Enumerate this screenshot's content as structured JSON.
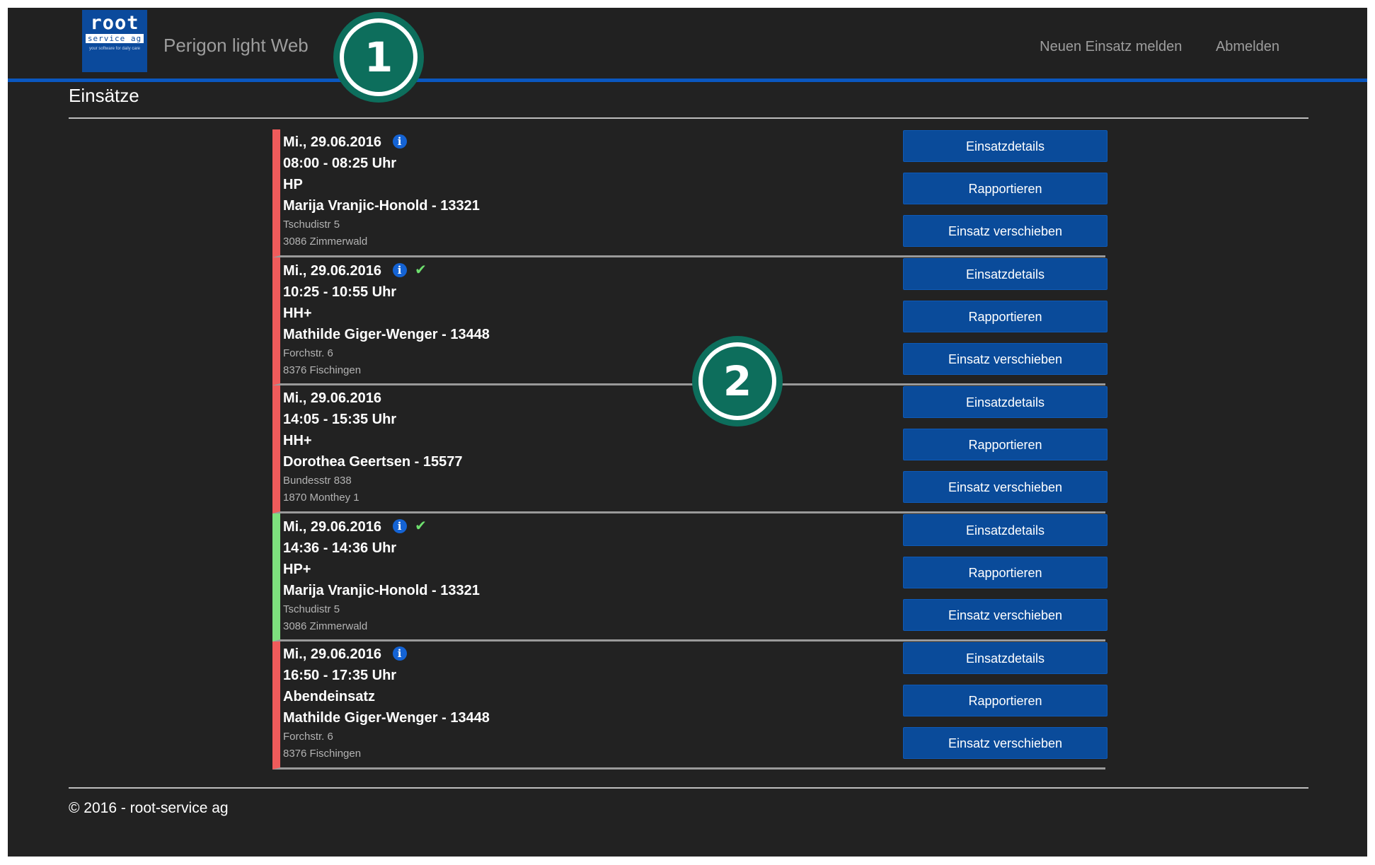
{
  "navbar": {
    "logo": {
      "line1": "root",
      "line2": "service ag",
      "line3": "your software for daily care"
    },
    "brand": "Perigon light Web",
    "links": [
      "Neuen Einsatz melden",
      "Abmelden"
    ]
  },
  "callouts": [
    "1",
    "2"
  ],
  "page_title": "Einsätze",
  "buttons": {
    "details": "Einsatzdetails",
    "report": "Rapportieren",
    "move": "Einsatz verschieben"
  },
  "assignments": [
    {
      "date": "Mi., 29.06.2016",
      "time": "08:00 - 08:25 Uhr",
      "type": "HP",
      "client": "Marija Vranjic-Honold - 13321",
      "street": "Tschudistr 5",
      "city": "3086 Zimmerwald",
      "has_info": true,
      "checked": false,
      "status": "open",
      "status_color": "#ef5b5b"
    },
    {
      "date": "Mi., 29.06.2016",
      "time": "10:25 - 10:55 Uhr",
      "type": "HH+",
      "client": "Mathilde Giger-Wenger - 13448",
      "street": "Forchstr. 6",
      "city": "8376 Fischingen",
      "has_info": true,
      "checked": true,
      "status": "open",
      "status_color": "#ef5b5b"
    },
    {
      "date": "Mi., 29.06.2016",
      "time": "14:05 - 15:35 Uhr",
      "type": "HH+",
      "client": "Dorothea Geertsen - 15577",
      "street": "Bundesstr 838",
      "city": "1870 Monthey 1",
      "has_info": false,
      "checked": false,
      "status": "open",
      "status_color": "#ef5b5b"
    },
    {
      "date": "Mi., 29.06.2016",
      "time": "14:36 - 14:36 Uhr",
      "type": "HP+",
      "client": "Marija Vranjic-Honold - 13321",
      "street": "Tschudistr 5",
      "city": "3086 Zimmerwald",
      "has_info": true,
      "checked": true,
      "status": "done",
      "status_color": "#7de07d"
    },
    {
      "date": "Mi., 29.06.2016",
      "time": "16:50 - 17:35 Uhr",
      "type": "Abendeinsatz",
      "client": "Mathilde Giger-Wenger - 13448",
      "street": "Forchstr. 6",
      "city": "8376 Fischingen",
      "has_info": true,
      "checked": false,
      "status": "open",
      "status_color": "#ef5b5b"
    }
  ],
  "footer": "© 2016 - root-service ag",
  "colors": {
    "background": "#222222",
    "nav_accent": "#0a57c0",
    "button": "#0a4b9a",
    "callout": "#0d6e5c",
    "info_icon": "#1463d4",
    "check_icon": "#6ee06e"
  }
}
